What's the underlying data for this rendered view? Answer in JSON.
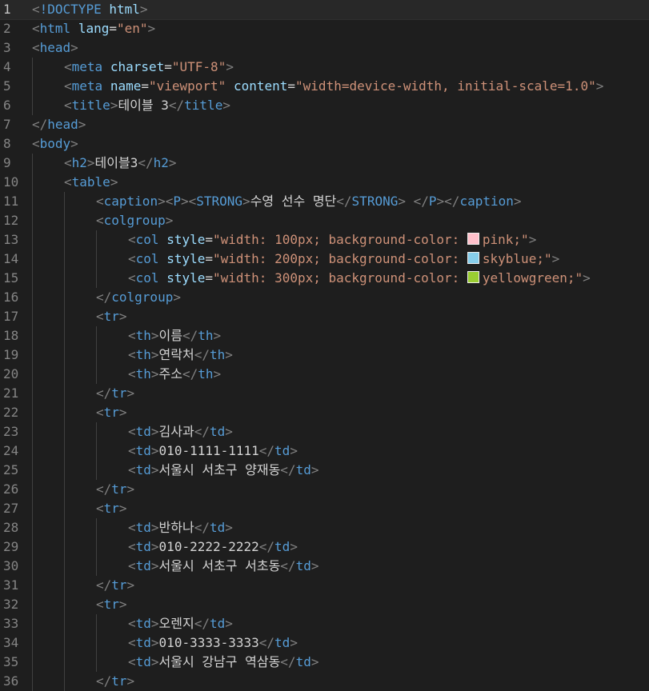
{
  "editor": {
    "colors": {
      "background": "#1e1e1e",
      "tag": "#569cd6",
      "bracket": "#808080",
      "attribute": "#9cdcfe",
      "string": "#ce9178",
      "text": "#d4d4d4",
      "line_number": "#858585"
    },
    "active_line": 1,
    "lines": [
      {
        "n": "1",
        "indent": 0,
        "t": [
          [
            "ang",
            "<"
          ],
          [
            "tag",
            "!DOCTYPE"
          ],
          [
            "txt",
            " "
          ],
          [
            "attr",
            "html"
          ],
          [
            "ang",
            ">"
          ]
        ]
      },
      {
        "n": "2",
        "indent": 0,
        "t": [
          [
            "ang",
            "<"
          ],
          [
            "tag",
            "html"
          ],
          [
            "txt",
            " "
          ],
          [
            "attr",
            "lang"
          ],
          [
            "txt",
            "="
          ],
          [
            "str",
            "\"en\""
          ],
          [
            "ang",
            ">"
          ]
        ]
      },
      {
        "n": "3",
        "indent": 0,
        "t": [
          [
            "ang",
            "<"
          ],
          [
            "tag",
            "head"
          ],
          [
            "ang",
            ">"
          ]
        ]
      },
      {
        "n": "4",
        "indent": 1,
        "t": [
          [
            "ang",
            "<"
          ],
          [
            "tag",
            "meta"
          ],
          [
            "txt",
            " "
          ],
          [
            "attr",
            "charset"
          ],
          [
            "txt",
            "="
          ],
          [
            "str",
            "\"UTF-8\""
          ],
          [
            "ang",
            ">"
          ]
        ]
      },
      {
        "n": "5",
        "indent": 1,
        "t": [
          [
            "ang",
            "<"
          ],
          [
            "tag",
            "meta"
          ],
          [
            "txt",
            " "
          ],
          [
            "attr",
            "name"
          ],
          [
            "txt",
            "="
          ],
          [
            "str",
            "\"viewport\""
          ],
          [
            "txt",
            " "
          ],
          [
            "attr",
            "content"
          ],
          [
            "txt",
            "="
          ],
          [
            "str",
            "\"width=device-width, initial-scale=1.0\""
          ],
          [
            "ang",
            ">"
          ]
        ]
      },
      {
        "n": "6",
        "indent": 1,
        "t": [
          [
            "ang",
            "<"
          ],
          [
            "tag",
            "title"
          ],
          [
            "ang",
            ">"
          ],
          [
            "txt",
            "테이블 3"
          ],
          [
            "ang",
            "</"
          ],
          [
            "tag",
            "title"
          ],
          [
            "ang",
            ">"
          ]
        ]
      },
      {
        "n": "7",
        "indent": 0,
        "t": [
          [
            "ang",
            "</"
          ],
          [
            "tag",
            "head"
          ],
          [
            "ang",
            ">"
          ]
        ]
      },
      {
        "n": "8",
        "indent": 0,
        "t": [
          [
            "ang",
            "<"
          ],
          [
            "tag",
            "body"
          ],
          [
            "ang",
            ">"
          ]
        ]
      },
      {
        "n": "9",
        "indent": 1,
        "t": [
          [
            "ang",
            "<"
          ],
          [
            "tag",
            "h2"
          ],
          [
            "ang",
            ">"
          ],
          [
            "txt",
            "테이블3"
          ],
          [
            "ang",
            "</"
          ],
          [
            "tag",
            "h2"
          ],
          [
            "ang",
            ">"
          ]
        ]
      },
      {
        "n": "10",
        "indent": 1,
        "t": [
          [
            "ang",
            "<"
          ],
          [
            "tag",
            "table"
          ],
          [
            "ang",
            ">"
          ]
        ]
      },
      {
        "n": "11",
        "indent": 2,
        "t": [
          [
            "ang",
            "<"
          ],
          [
            "tag",
            "caption"
          ],
          [
            "ang",
            "><"
          ],
          [
            "tag",
            "P"
          ],
          [
            "ang",
            "><"
          ],
          [
            "tag",
            "STRONG"
          ],
          [
            "ang",
            ">"
          ],
          [
            "txt",
            "수영 선수 명단"
          ],
          [
            "ang",
            "</"
          ],
          [
            "tag",
            "STRONG"
          ],
          [
            "ang",
            ">"
          ],
          [
            "txt",
            " "
          ],
          [
            "ang",
            "</"
          ],
          [
            "tag",
            "P"
          ],
          [
            "ang",
            "></"
          ],
          [
            "tag",
            "caption"
          ],
          [
            "ang",
            ">"
          ]
        ]
      },
      {
        "n": "12",
        "indent": 2,
        "t": [
          [
            "ang",
            "<"
          ],
          [
            "tag",
            "colgroup"
          ],
          [
            "ang",
            ">"
          ]
        ]
      },
      {
        "n": "13",
        "indent": 3,
        "t": [
          [
            "ang",
            "<"
          ],
          [
            "tag",
            "col"
          ],
          [
            "txt",
            " "
          ],
          [
            "attr",
            "style"
          ],
          [
            "txt",
            "="
          ],
          [
            "str",
            "\"width: 100px; background-color: "
          ],
          [
            "swatch",
            "#ffc0cb"
          ],
          [
            "str",
            "pink;\""
          ],
          [
            "ang",
            ">"
          ]
        ]
      },
      {
        "n": "14",
        "indent": 3,
        "t": [
          [
            "ang",
            "<"
          ],
          [
            "tag",
            "col"
          ],
          [
            "txt",
            " "
          ],
          [
            "attr",
            "style"
          ],
          [
            "txt",
            "="
          ],
          [
            "str",
            "\"width: 200px; background-color: "
          ],
          [
            "swatch",
            "#87ceeb"
          ],
          [
            "str",
            "skyblue;\""
          ],
          [
            "ang",
            ">"
          ]
        ]
      },
      {
        "n": "15",
        "indent": 3,
        "t": [
          [
            "ang",
            "<"
          ],
          [
            "tag",
            "col"
          ],
          [
            "txt",
            " "
          ],
          [
            "attr",
            "style"
          ],
          [
            "txt",
            "="
          ],
          [
            "str",
            "\"width: 300px; background-color: "
          ],
          [
            "swatch",
            "#9acd32"
          ],
          [
            "str",
            "yellowgreen;\""
          ],
          [
            "ang",
            ">"
          ]
        ]
      },
      {
        "n": "16",
        "indent": 2,
        "t": [
          [
            "ang",
            "</"
          ],
          [
            "tag",
            "colgroup"
          ],
          [
            "ang",
            ">"
          ]
        ]
      },
      {
        "n": "17",
        "indent": 2,
        "t": [
          [
            "ang",
            "<"
          ],
          [
            "tag",
            "tr"
          ],
          [
            "ang",
            ">"
          ]
        ]
      },
      {
        "n": "18",
        "indent": 3,
        "t": [
          [
            "ang",
            "<"
          ],
          [
            "tag",
            "th"
          ],
          [
            "ang",
            ">"
          ],
          [
            "txt",
            "이름"
          ],
          [
            "ang",
            "</"
          ],
          [
            "tag",
            "th"
          ],
          [
            "ang",
            ">"
          ]
        ]
      },
      {
        "n": "19",
        "indent": 3,
        "t": [
          [
            "ang",
            "<"
          ],
          [
            "tag",
            "th"
          ],
          [
            "ang",
            ">"
          ],
          [
            "txt",
            "연락처"
          ],
          [
            "ang",
            "</"
          ],
          [
            "tag",
            "th"
          ],
          [
            "ang",
            ">"
          ]
        ]
      },
      {
        "n": "20",
        "indent": 3,
        "t": [
          [
            "ang",
            "<"
          ],
          [
            "tag",
            "th"
          ],
          [
            "ang",
            ">"
          ],
          [
            "txt",
            "주소"
          ],
          [
            "ang",
            "</"
          ],
          [
            "tag",
            "th"
          ],
          [
            "ang",
            ">"
          ]
        ]
      },
      {
        "n": "21",
        "indent": 2,
        "t": [
          [
            "ang",
            "</"
          ],
          [
            "tag",
            "tr"
          ],
          [
            "ang",
            ">"
          ]
        ]
      },
      {
        "n": "22",
        "indent": 2,
        "t": [
          [
            "ang",
            "<"
          ],
          [
            "tag",
            "tr"
          ],
          [
            "ang",
            ">"
          ]
        ]
      },
      {
        "n": "23",
        "indent": 3,
        "t": [
          [
            "ang",
            "<"
          ],
          [
            "tag",
            "td"
          ],
          [
            "ang",
            ">"
          ],
          [
            "txt",
            "김사과"
          ],
          [
            "ang",
            "</"
          ],
          [
            "tag",
            "td"
          ],
          [
            "ang",
            ">"
          ]
        ]
      },
      {
        "n": "24",
        "indent": 3,
        "t": [
          [
            "ang",
            "<"
          ],
          [
            "tag",
            "td"
          ],
          [
            "ang",
            ">"
          ],
          [
            "txt",
            "010-1111-1111"
          ],
          [
            "ang",
            "</"
          ],
          [
            "tag",
            "td"
          ],
          [
            "ang",
            ">"
          ]
        ]
      },
      {
        "n": "25",
        "indent": 3,
        "t": [
          [
            "ang",
            "<"
          ],
          [
            "tag",
            "td"
          ],
          [
            "ang",
            ">"
          ],
          [
            "txt",
            "서울시 서초구 양재동"
          ],
          [
            "ang",
            "</"
          ],
          [
            "tag",
            "td"
          ],
          [
            "ang",
            ">"
          ]
        ]
      },
      {
        "n": "26",
        "indent": 2,
        "t": [
          [
            "ang",
            "</"
          ],
          [
            "tag",
            "tr"
          ],
          [
            "ang",
            ">"
          ]
        ]
      },
      {
        "n": "27",
        "indent": 2,
        "t": [
          [
            "ang",
            "<"
          ],
          [
            "tag",
            "tr"
          ],
          [
            "ang",
            ">"
          ]
        ]
      },
      {
        "n": "28",
        "indent": 3,
        "t": [
          [
            "ang",
            "<"
          ],
          [
            "tag",
            "td"
          ],
          [
            "ang",
            ">"
          ],
          [
            "txt",
            "반하나"
          ],
          [
            "ang",
            "</"
          ],
          [
            "tag",
            "td"
          ],
          [
            "ang",
            ">"
          ]
        ]
      },
      {
        "n": "29",
        "indent": 3,
        "t": [
          [
            "ang",
            "<"
          ],
          [
            "tag",
            "td"
          ],
          [
            "ang",
            ">"
          ],
          [
            "txt",
            "010-2222-2222"
          ],
          [
            "ang",
            "</"
          ],
          [
            "tag",
            "td"
          ],
          [
            "ang",
            ">"
          ]
        ]
      },
      {
        "n": "30",
        "indent": 3,
        "t": [
          [
            "ang",
            "<"
          ],
          [
            "tag",
            "td"
          ],
          [
            "ang",
            ">"
          ],
          [
            "txt",
            "서울시 서초구 서초동"
          ],
          [
            "ang",
            "</"
          ],
          [
            "tag",
            "td"
          ],
          [
            "ang",
            ">"
          ]
        ]
      },
      {
        "n": "31",
        "indent": 2,
        "t": [
          [
            "ang",
            "</"
          ],
          [
            "tag",
            "tr"
          ],
          [
            "ang",
            ">"
          ]
        ]
      },
      {
        "n": "32",
        "indent": 2,
        "t": [
          [
            "ang",
            "<"
          ],
          [
            "tag",
            "tr"
          ],
          [
            "ang",
            ">"
          ]
        ]
      },
      {
        "n": "33",
        "indent": 3,
        "t": [
          [
            "ang",
            "<"
          ],
          [
            "tag",
            "td"
          ],
          [
            "ang",
            ">"
          ],
          [
            "txt",
            "오렌지"
          ],
          [
            "ang",
            "</"
          ],
          [
            "tag",
            "td"
          ],
          [
            "ang",
            ">"
          ]
        ]
      },
      {
        "n": "34",
        "indent": 3,
        "t": [
          [
            "ang",
            "<"
          ],
          [
            "tag",
            "td"
          ],
          [
            "ang",
            ">"
          ],
          [
            "txt",
            "010-3333-3333"
          ],
          [
            "ang",
            "</"
          ],
          [
            "tag",
            "td"
          ],
          [
            "ang",
            ">"
          ]
        ]
      },
      {
        "n": "35",
        "indent": 3,
        "t": [
          [
            "ang",
            "<"
          ],
          [
            "tag",
            "td"
          ],
          [
            "ang",
            ">"
          ],
          [
            "txt",
            "서울시 강남구 역삼동"
          ],
          [
            "ang",
            "</"
          ],
          [
            "tag",
            "td"
          ],
          [
            "ang",
            ">"
          ]
        ]
      },
      {
        "n": "36",
        "indent": 2,
        "t": [
          [
            "ang",
            "</"
          ],
          [
            "tag",
            "tr"
          ],
          [
            "ang",
            ">"
          ]
        ]
      }
    ]
  }
}
